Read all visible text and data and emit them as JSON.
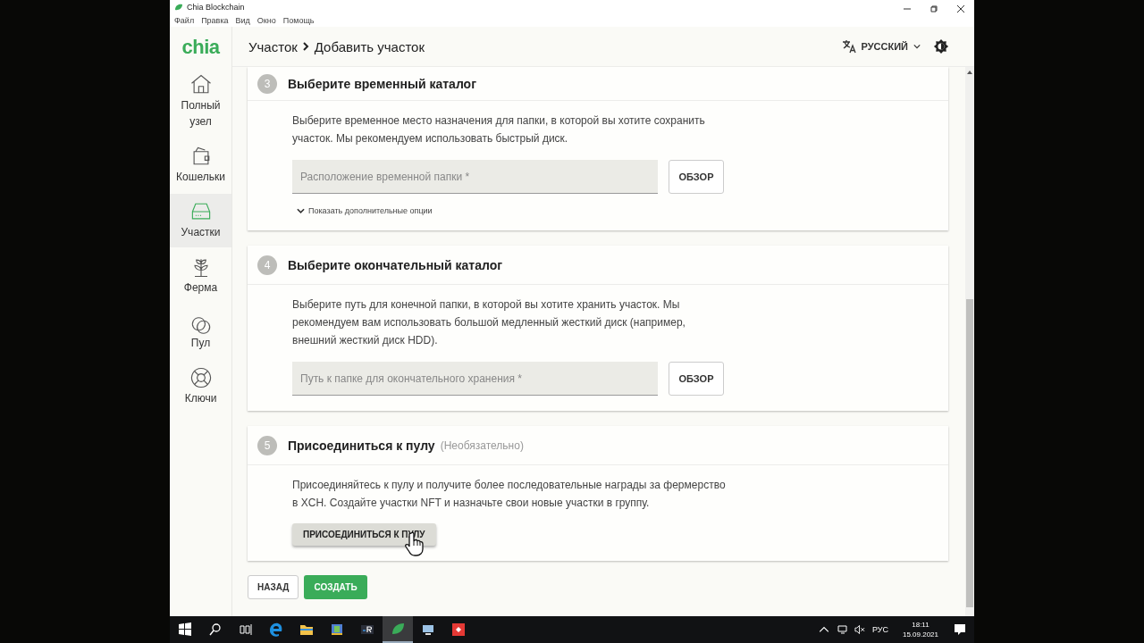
{
  "window": {
    "title": "Chia Blockchain",
    "menu": [
      "Файл",
      "Правка",
      "Вид",
      "Окно",
      "Помощь"
    ]
  },
  "header": {
    "logo": "chia",
    "breadcrumb": [
      "Участок",
      "Добавить участок"
    ],
    "language": "РУССКИЙ"
  },
  "sidebar": {
    "items": [
      {
        "label": "Полный узел",
        "kind": "home",
        "selected": false
      },
      {
        "label": "Кошельки",
        "kind": "wallet",
        "selected": false
      },
      {
        "label": "Участки",
        "kind": "drive",
        "selected": true
      },
      {
        "label": "Ферма",
        "kind": "plant",
        "selected": false
      },
      {
        "label": "Пул",
        "kind": "rings",
        "selected": false
      },
      {
        "label": "Ключи",
        "kind": "lifebuoy",
        "selected": false
      }
    ]
  },
  "steps": [
    {
      "number": "3",
      "title": "Выберите временный каталог",
      "description": "Выберите временное место назначения для папки, в которой вы хотите сохранить участок. Мы рекомендуем использовать быстрый диск.",
      "placeholder": "Расположение временной папки *",
      "browse": "ОБЗОР",
      "options": "Показать дополнительные опции"
    },
    {
      "number": "4",
      "title": "Выберите окончательный каталог",
      "description": "Выберите путь для конечной папки, в которой вы хотите хранить участок. Мы рекомендуем вам использовать большой медленный жесткий диск (например, внешний жесткий диск HDD).",
      "placeholder": "Путь к папке для окончательного хранения *",
      "browse": "ОБЗОР"
    },
    {
      "number": "5",
      "title": "Присоединиться к пулу",
      "optional": "(Необязательно)",
      "description": "Присоединяйтесь к пулу и получите более последовательные награды за фермерство в XCH. Создайте участки NFT и назначьте свои новые участки в группу.",
      "button": "ПРИСОЕДИНИТЬСЯ К ПУЛУ"
    }
  ],
  "actions": {
    "back": "НАЗАД",
    "create": "СОЗДАТЬ"
  },
  "taskbar": {
    "apps": [
      {
        "kind": "start",
        "selected": false
      },
      {
        "kind": "search",
        "selected": false
      },
      {
        "kind": "taskview",
        "selected": false
      },
      {
        "kind": "edge",
        "selected": false
      },
      {
        "kind": "folder",
        "selected": false
      },
      {
        "kind": "book",
        "selected": false
      },
      {
        "kind": "r",
        "selected": false
      },
      {
        "kind": "leaf",
        "selected": true
      },
      {
        "kind": "network",
        "selected": false
      },
      {
        "kind": "red",
        "selected": false
      }
    ],
    "language": "РУС",
    "time": "18:11",
    "date": "15.09.2021"
  }
}
